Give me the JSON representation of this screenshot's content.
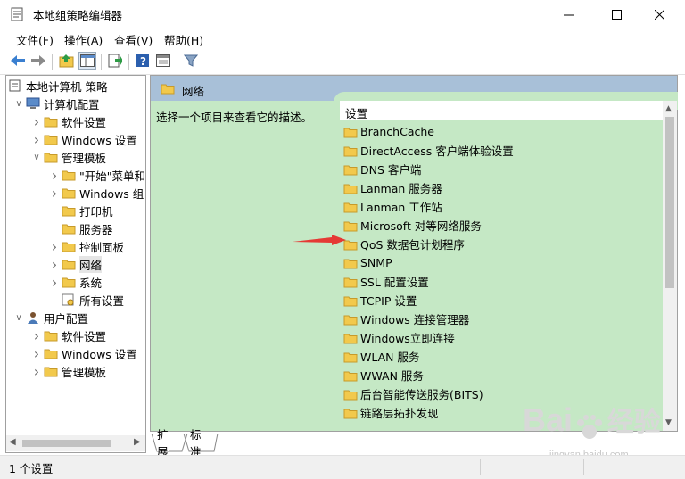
{
  "window": {
    "title": "本地组策略编辑器"
  },
  "menu": [
    "文件(F)",
    "操作(A)",
    "查看(V)",
    "帮助(H)"
  ],
  "toolbar": {
    "icons": [
      "back-icon",
      "forward-icon",
      "up-folder-icon",
      "show-hide-tree-icon",
      "export-icon",
      "help-icon",
      "properties-icon",
      "filter-icon"
    ]
  },
  "tree": [
    {
      "label": "本地计算机 策略",
      "icon": "policy-icon"
    },
    {
      "label": "计算机配置",
      "icon": "computer-icon",
      "expanded": true
    },
    {
      "label": "软件设置",
      "icon": "folder-icon"
    },
    {
      "label": "Windows 设置",
      "icon": "folder-icon"
    },
    {
      "label": "管理模板",
      "icon": "folder-icon",
      "expanded": true
    },
    {
      "label": "\"开始\"菜单和",
      "icon": "folder-icon"
    },
    {
      "label": "Windows 组",
      "icon": "folder-icon"
    },
    {
      "label": "打印机",
      "icon": "folder-icon"
    },
    {
      "label": "服务器",
      "icon": "folder-icon"
    },
    {
      "label": "控制面板",
      "icon": "folder-icon"
    },
    {
      "label": "网络",
      "icon": "folder-icon",
      "selected": true
    },
    {
      "label": "系统",
      "icon": "folder-icon"
    },
    {
      "label": "所有设置",
      "icon": "settings-icon"
    },
    {
      "label": "用户配置",
      "icon": "user-icon",
      "expanded": true
    },
    {
      "label": "软件设置",
      "icon": "folder-icon"
    },
    {
      "label": "Windows 设置",
      "icon": "folder-icon"
    },
    {
      "label": "管理模板",
      "icon": "folder-icon"
    }
  ],
  "right": {
    "header": "网络",
    "description": "选择一个项目来查看它的描述。",
    "column_header": "设置",
    "items": [
      "BranchCache",
      "DirectAccess 客户端体验设置",
      "DNS 客户端",
      "Lanman 服务器",
      "Lanman 工作站",
      "Microsoft 对等网络服务",
      "QoS 数据包计划程序",
      "SNMP",
      "SSL 配置设置",
      "TCPIP 设置",
      "Windows 连接管理器",
      "Windows立即连接",
      "WLAN 服务",
      "WWAN 服务",
      "后台智能传送服务(BITS)",
      "链路层拓扑发现"
    ]
  },
  "tabs": [
    "扩展",
    "标准"
  ],
  "status": "1 个设置",
  "watermark": {
    "brand": "Bai",
    "site": "jingyan.baidu.com",
    "cn": "经验"
  },
  "colors": {
    "pane_bg": "#c5e8c5",
    "header_bg": "#a8c0d8",
    "folder": "#f2c94c",
    "annotation": "#e53935"
  }
}
